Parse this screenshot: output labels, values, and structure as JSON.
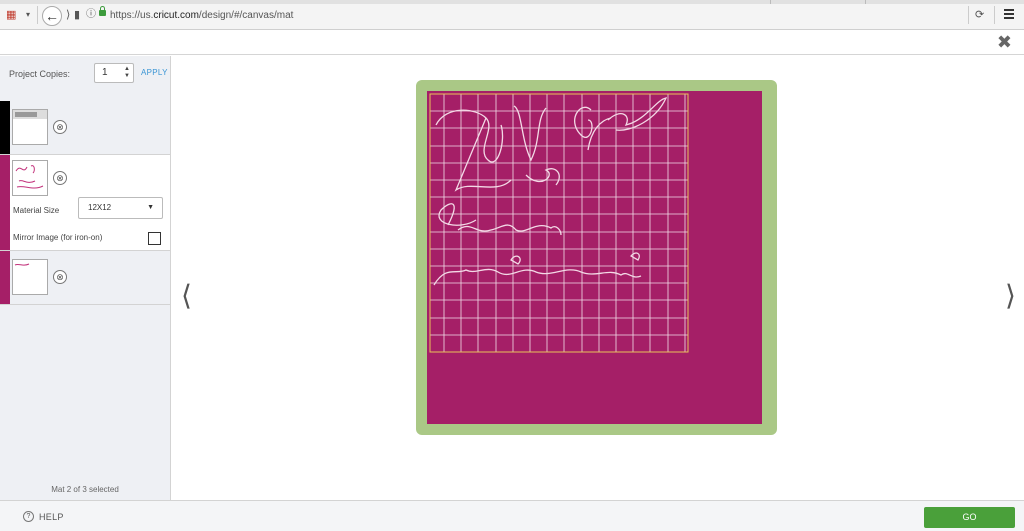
{
  "browser": {
    "url_prefix": "https://us.",
    "url_host": "cricut.com",
    "url_path": "/design/#/canvas/mat"
  },
  "sidebar": {
    "project_copies_label": "Project Copies:",
    "project_copies_value": "1",
    "apply_label": "APPLY",
    "mats": [
      {
        "color": "#000000",
        "selected": false
      },
      {
        "color": "#a51f67",
        "selected": true,
        "material_size_label": "Material Size",
        "material_size_value": "12X12",
        "mirror_label": "Mirror Image (for iron-on)",
        "mirror_checked": false
      },
      {
        "color": "#a51f67",
        "selected": false
      }
    ],
    "status": "Mat 2 of 3 selected"
  },
  "canvas": {
    "mat_color": "#aac886",
    "material_color": "#a51f67",
    "design_lines": [
      "Lm Gra",
      "better",
      "ndmother"
    ]
  },
  "footer": {
    "help_label": "HELP",
    "go_label": "GO"
  }
}
